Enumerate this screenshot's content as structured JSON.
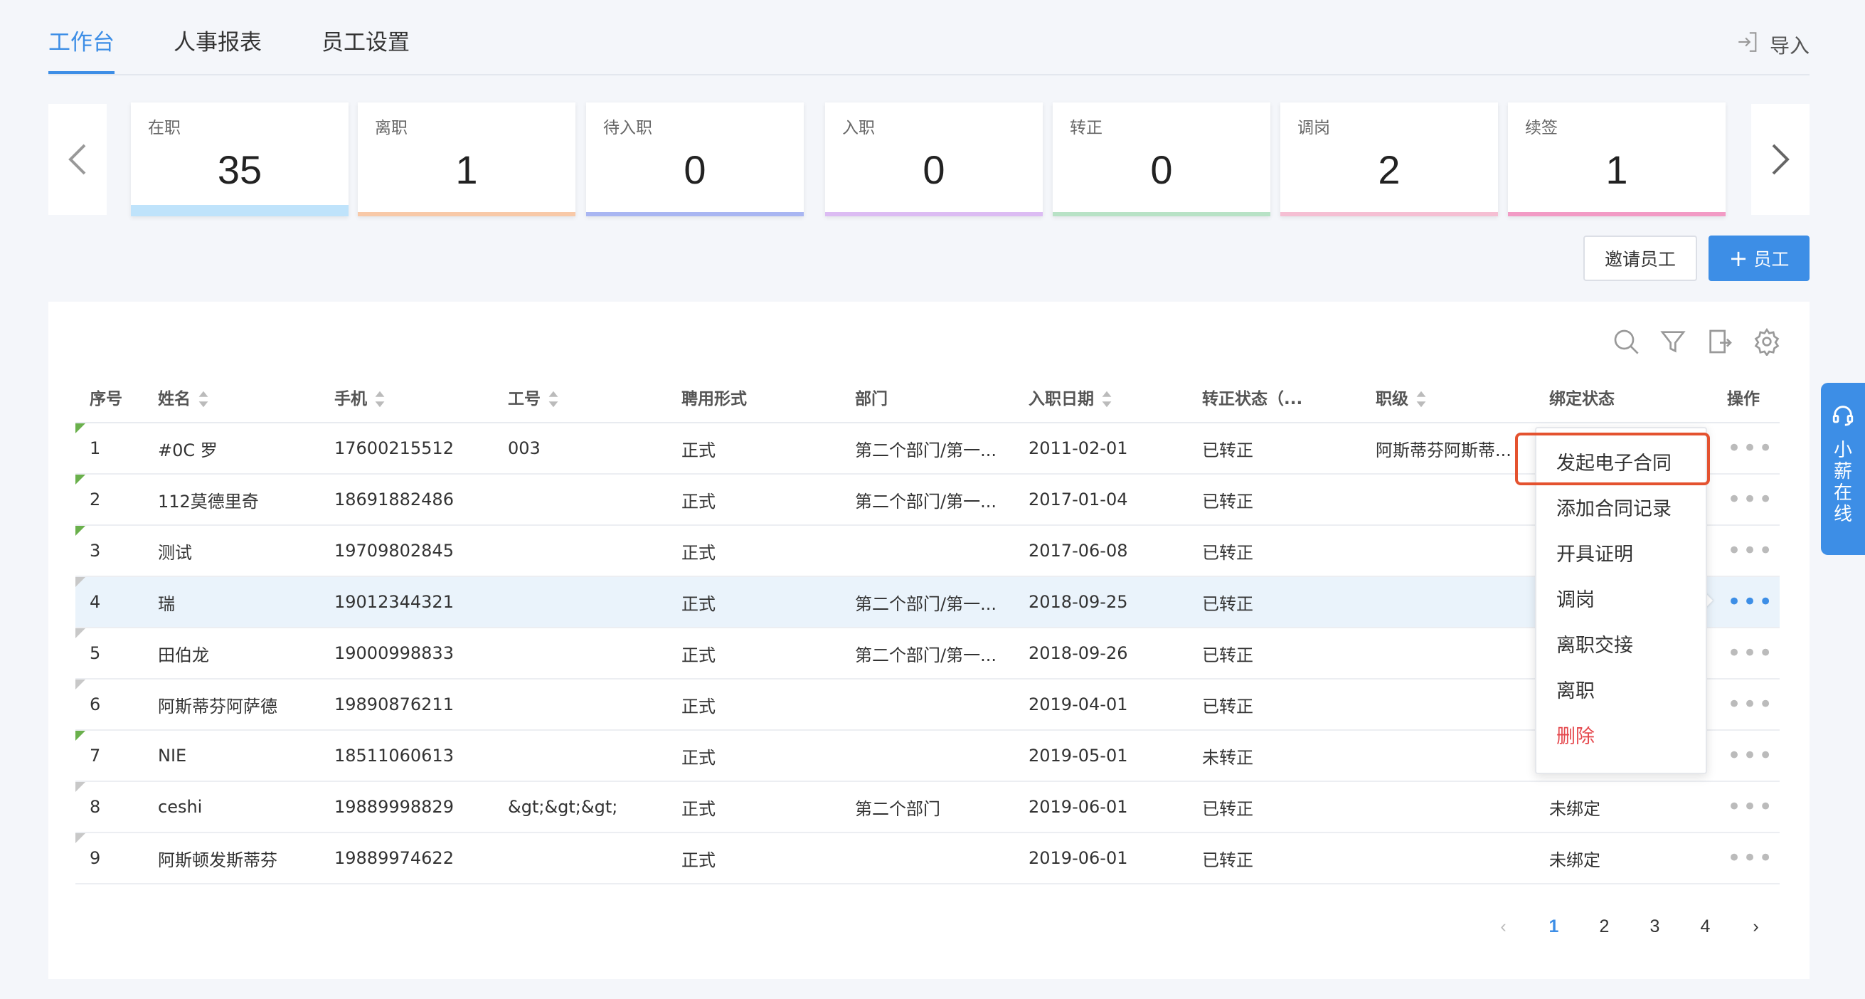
{
  "tabs": [
    {
      "label": "工作台",
      "active": true
    },
    {
      "label": "人事报表",
      "active": false
    },
    {
      "label": "员工设置",
      "active": false
    }
  ],
  "import_label": "导入",
  "stats": [
    {
      "label": "在职",
      "value": "35",
      "color": "#bfe3fb"
    },
    {
      "label": "离职",
      "value": "1",
      "color": "#f8c9a8"
    },
    {
      "label": "待入职",
      "value": "0",
      "color": "#a9b6f2"
    },
    {
      "label": "入职",
      "value": "0",
      "color": "#dcbcf3"
    },
    {
      "label": "转正",
      "value": "0",
      "color": "#b8e2c6"
    },
    {
      "label": "调岗",
      "value": "2",
      "color": "#f5bfd3"
    },
    {
      "label": "续签",
      "value": "1",
      "color": "#f29bc5"
    }
  ],
  "buttons": {
    "invite": "邀请员工",
    "add": "员工"
  },
  "columns": [
    "序号",
    "姓名",
    "手机",
    "工号",
    "聘用形式",
    "部门",
    "入职日期",
    "转正状态（...",
    "职级",
    "绑定状态",
    "操作"
  ],
  "rows": [
    {
      "no": "1",
      "name": "#0C 罗",
      "phone": "17600215512",
      "empid": "003",
      "type": "正式",
      "dept": "第二个部门/第一...",
      "date": "2011-02-01",
      "status": "已转正",
      "level": "阿斯蒂芬阿斯蒂...",
      "bind": "",
      "mark": "green"
    },
    {
      "no": "2",
      "name": "112莫德里奇",
      "phone": "18691882486",
      "empid": "",
      "type": "正式",
      "dept": "第二个部门/第一...",
      "date": "2017-01-04",
      "status": "已转正",
      "level": "",
      "bind": "",
      "mark": "green"
    },
    {
      "no": "3",
      "name": "测试",
      "phone": "19709802845",
      "empid": "",
      "type": "正式",
      "dept": "",
      "date": "2017-06-08",
      "status": "已转正",
      "level": "",
      "bind": "",
      "mark": "green"
    },
    {
      "no": "4",
      "name": "瑞",
      "phone": "19012344321",
      "empid": "",
      "type": "正式",
      "dept": "第二个部门/第一...",
      "date": "2018-09-25",
      "status": "已转正",
      "level": "",
      "bind": "",
      "mark": "gray"
    },
    {
      "no": "5",
      "name": "田伯龙",
      "phone": "19000998833",
      "empid": "",
      "type": "正式",
      "dept": "第二个部门/第一...",
      "date": "2018-09-26",
      "status": "已转正",
      "level": "",
      "bind": "",
      "mark": "gray"
    },
    {
      "no": "6",
      "name": "阿斯蒂芬阿萨德",
      "phone": "19890876211",
      "empid": "",
      "type": "正式",
      "dept": "",
      "date": "2019-04-01",
      "status": "已转正",
      "level": "",
      "bind": "",
      "mark": "gray"
    },
    {
      "no": "7",
      "name": "NIE",
      "phone": "18511060613",
      "empid": "",
      "type": "正式",
      "dept": "",
      "date": "2019-05-01",
      "status": "未转正",
      "level": "",
      "bind": "",
      "mark": "green"
    },
    {
      "no": "8",
      "name": "ceshi",
      "phone": "19889998829",
      "empid": "&gt;&gt;&gt;",
      "type": "正式",
      "dept": "第二个部门",
      "date": "2019-06-01",
      "status": "已转正",
      "level": "",
      "bind": "未绑定",
      "mark": "gray"
    },
    {
      "no": "9",
      "name": "阿斯顿发斯蒂芬",
      "phone": "19889974622",
      "empid": "",
      "type": "正式",
      "dept": "",
      "date": "2019-06-01",
      "status": "已转正",
      "level": "",
      "bind": "未绑定",
      "mark": "gray"
    }
  ],
  "menu": [
    "发起电子合同",
    "添加合同记录",
    "开具证明",
    "调岗",
    "离职交接",
    "离职",
    "删除"
  ],
  "pagination": {
    "pages": [
      "1",
      "2",
      "3",
      "4"
    ],
    "current": "1"
  },
  "chat_label": "小薪在线"
}
